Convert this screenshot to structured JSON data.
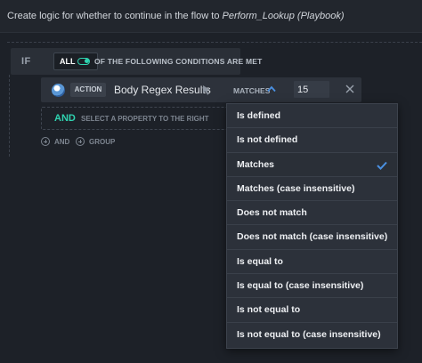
{
  "header": {
    "prefix": "Create logic for whether to continue in the flow to ",
    "target": "Perform_Lookup (Playbook)"
  },
  "if_block": {
    "if_label": "IF",
    "all_label": "ALL",
    "conditions_text": "OF THE FOLLOWING CONDITIONS ARE MET",
    "toggle_on": true
  },
  "condition": {
    "tag": "ACTION",
    "property": "Body Regex Results",
    "operator": "MATCHES",
    "value": "15"
  },
  "and_row": {
    "and_label": "AND",
    "hint": "SELECT A PROPERTY TO THE RIGHT"
  },
  "add_links": {
    "and_label": "AND",
    "group_label": "GROUP"
  },
  "dropdown": {
    "selected": "Matches",
    "options": [
      "Is defined",
      "Is not defined",
      "Matches",
      "Matches (case insensitive)",
      "Does not match",
      "Does not match (case insensitive)",
      "Is equal to",
      "Is equal to (case insensitive)",
      "Is not equal to",
      "Is not equal to (case insensitive)"
    ]
  },
  "colors": {
    "accent_teal": "#2fd3b0",
    "check_blue": "#4a90e2",
    "background": "#1d2128"
  },
  "icons": {
    "globe": "globe-icon",
    "cursor": "cursor-icon",
    "caret": "chevron-up-icon",
    "close": "close-icon",
    "check": "check-icon",
    "plus": "plus-circle-icon"
  }
}
